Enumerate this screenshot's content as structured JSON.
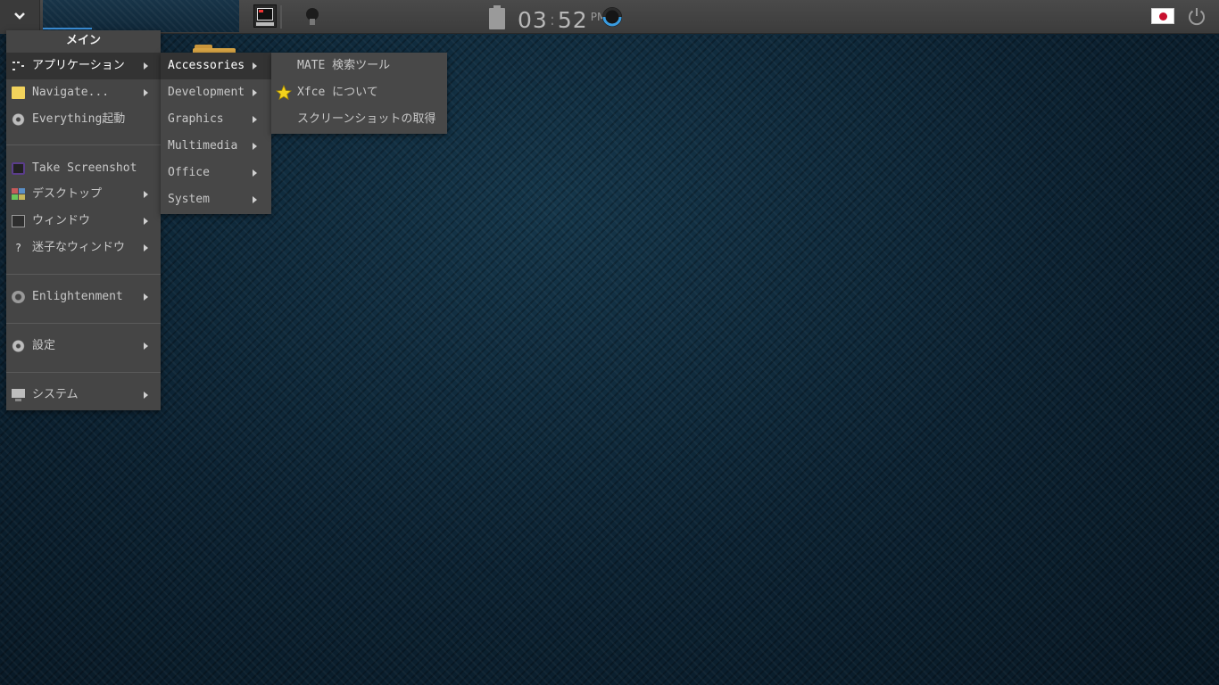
{
  "shelf": {
    "clock": {
      "hour": "03",
      "minute": "52",
      "separator": ":",
      "ampm": "PM"
    },
    "icons": [
      "chevron-down-icon",
      "terminal-icon",
      "lightbulb-icon",
      "battery-icon",
      "spinner-icon",
      "japan-flag-icon",
      "power-icon"
    ]
  },
  "main_menu": {
    "title": "メイン",
    "items": [
      {
        "label": "アプリケーション",
        "icon": "applications-icon",
        "submenu": true,
        "selected": true
      },
      {
        "label": "Navigate...",
        "icon": "folder-icon",
        "submenu": true
      },
      {
        "label": "Everything起動",
        "icon": "gear-icon",
        "submenu": false
      },
      {
        "label": "Take Screenshot",
        "icon": "camera-icon",
        "submenu": false
      },
      {
        "label": "デスクトップ",
        "icon": "desktop-icon",
        "submenu": true
      },
      {
        "label": "ウィンドウ",
        "icon": "window-icon",
        "submenu": true
      },
      {
        "label": "迷子なウィンドウ",
        "icon": "lost-window-icon",
        "submenu": true
      },
      {
        "label": "Enlightenment",
        "icon": "enlightenment-icon",
        "submenu": true
      },
      {
        "label": "設定",
        "icon": "settings-gear-icon",
        "submenu": true
      },
      {
        "label": "システム",
        "icon": "system-icon",
        "submenu": true
      }
    ]
  },
  "applications_menu": {
    "items": [
      {
        "label": "Accessories",
        "selected": true
      },
      {
        "label": "Development"
      },
      {
        "label": "Graphics"
      },
      {
        "label": "Multimedia"
      },
      {
        "label": "Office"
      },
      {
        "label": "System"
      }
    ]
  },
  "accessories_menu": {
    "items": [
      {
        "label": "MATE 検索ツール",
        "icon": ""
      },
      {
        "label": "Xfce について",
        "icon": "star-icon"
      },
      {
        "label": "スクリーンショットの取得",
        "icon": ""
      }
    ]
  },
  "colors": {
    "shelf": "#404040",
    "menu": "#454545",
    "selected": "#333333",
    "accent": "#3a8fd9"
  }
}
